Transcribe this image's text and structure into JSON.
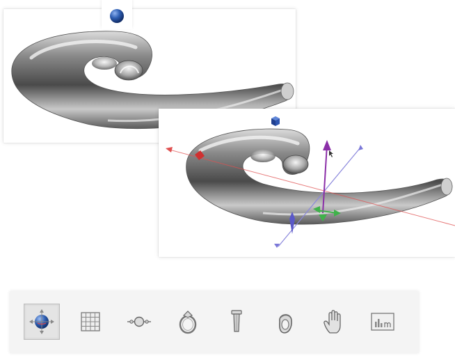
{
  "scene": {
    "object": "swirl-horn-model",
    "colors": {
      "metal_dark": "#4b4b4b",
      "metal_mid": "#9a9a9a",
      "metal_light": "#e6e6e6",
      "axis_x": "#e05050",
      "axis_y": "#8b2fa8",
      "axis_z": "#7b78d8",
      "handle_green": "#3fb24a",
      "sphere_blue": "#2f5fb3"
    }
  },
  "views": [
    {
      "mode": "sphere-rotate",
      "gizmo": "sphere-icon"
    },
    {
      "mode": "axis-move",
      "gizmo": "cube-icon"
    }
  ],
  "toolbar": {
    "tools": [
      {
        "name": "orbit-tool",
        "active": true
      },
      {
        "name": "grid-tool",
        "active": false
      },
      {
        "name": "gem-setting-tool",
        "active": false
      },
      {
        "name": "ring-tool",
        "active": false
      },
      {
        "name": "prong-tool",
        "active": false
      },
      {
        "name": "ring-shank-tool",
        "active": false
      },
      {
        "name": "pan-hand-tool",
        "active": false
      },
      {
        "name": "measure-tool",
        "active": false
      }
    ]
  }
}
